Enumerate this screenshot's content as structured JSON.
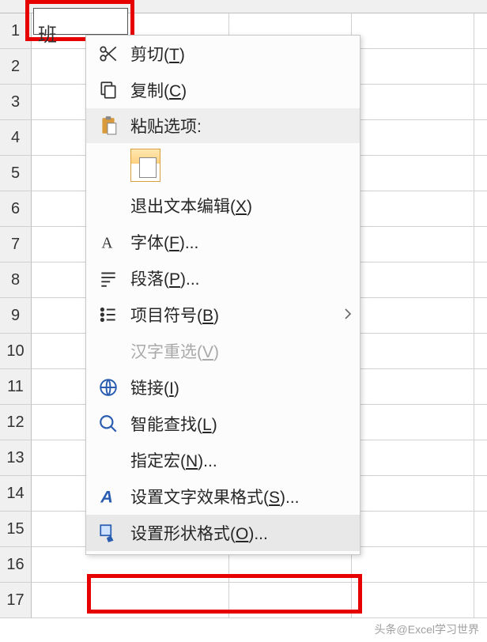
{
  "rows": [
    "1",
    "2",
    "3",
    "4",
    "5",
    "6",
    "7",
    "8",
    "9",
    "10",
    "11",
    "12",
    "13",
    "14",
    "15",
    "16",
    "17"
  ],
  "textbox": {
    "label": "班"
  },
  "menu": {
    "cut": "剪切(T)",
    "copy": "复制(C)",
    "paste_header": "粘贴选项:",
    "exit_text_edit": "退出文本编辑(X)",
    "font": "字体(F)...",
    "paragraph": "段落(P)...",
    "bullets": "项目符号(B)",
    "reconvert": "汉字重选(V)",
    "link": "链接(I)",
    "smart_lookup": "智能查找(L)",
    "assign_macro": "指定宏(N)...",
    "text_effects": "设置文字效果格式(S)...",
    "shape_format": "设置形状格式(O)..."
  },
  "watermark": "头条@Excel学习世界"
}
